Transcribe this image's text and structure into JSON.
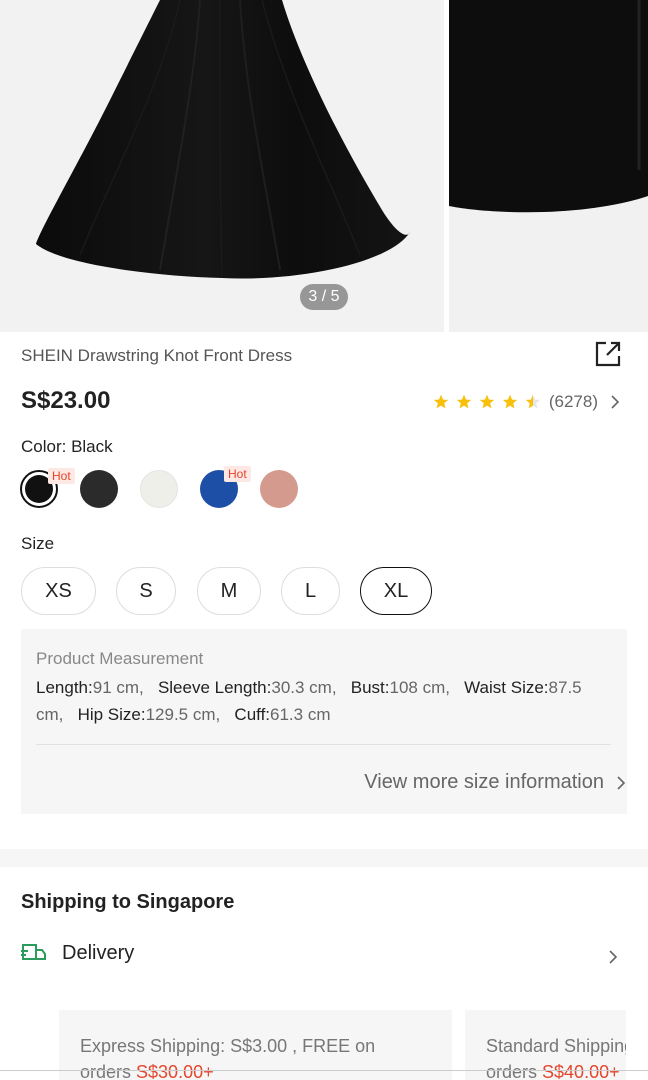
{
  "gallery": {
    "counter": "3 / 5"
  },
  "product": {
    "title": "SHEIN Drawstring Knot Front Dress",
    "price": "S$23.00",
    "rating_count": "(6278)",
    "rating_stars": 4.5,
    "star_color": "#f7c00d"
  },
  "color": {
    "label": "Color: Black",
    "hot_label": "Hot",
    "swatches": [
      {
        "name": "black",
        "color": "#111111",
        "hot": true,
        "selected": true
      },
      {
        "name": "black",
        "color": "#2b2b2b",
        "hot": false,
        "selected": false
      },
      {
        "name": "white",
        "color": "#efefea",
        "hot": false,
        "selected": false
      },
      {
        "name": "blue",
        "color": "#1d4fa6",
        "hot": true,
        "selected": false
      },
      {
        "name": "pink",
        "color": "#d49a8d",
        "hot": false,
        "selected": false
      }
    ]
  },
  "size": {
    "label": "Size",
    "options": [
      "XS",
      "S",
      "M",
      "L",
      "XL"
    ],
    "selected": "XL"
  },
  "measurement": {
    "title": "Product Measurement",
    "items": [
      {
        "name": "Length:",
        "value": "91 cm,"
      },
      {
        "name": "Sleeve Length:",
        "value": "30.3 cm,"
      },
      {
        "name": "Bust:",
        "value": "108 cm,"
      },
      {
        "name": "Waist Size:",
        "value": "87.5 cm,"
      },
      {
        "name": "Hip Size:",
        "value": "129.5 cm,"
      },
      {
        "name": "Cuff:",
        "value": "61.3 cm"
      }
    ],
    "more_link": "View more size information"
  },
  "shipping": {
    "title": "Shipping to Singapore",
    "delivery_label": "Delivery",
    "cards": [
      {
        "line1": "Express Shipping: S$3.00 , FREE on",
        "line2_prefix": "orders ",
        "line2_price": "S$30.00+"
      },
      {
        "line1": "Standard Shipping",
        "line2_prefix": "orders ",
        "line2_price": "S$40.00+"
      }
    ]
  },
  "accent_color": "#e5452c",
  "delivery_icon_color": "#2e9b5e"
}
